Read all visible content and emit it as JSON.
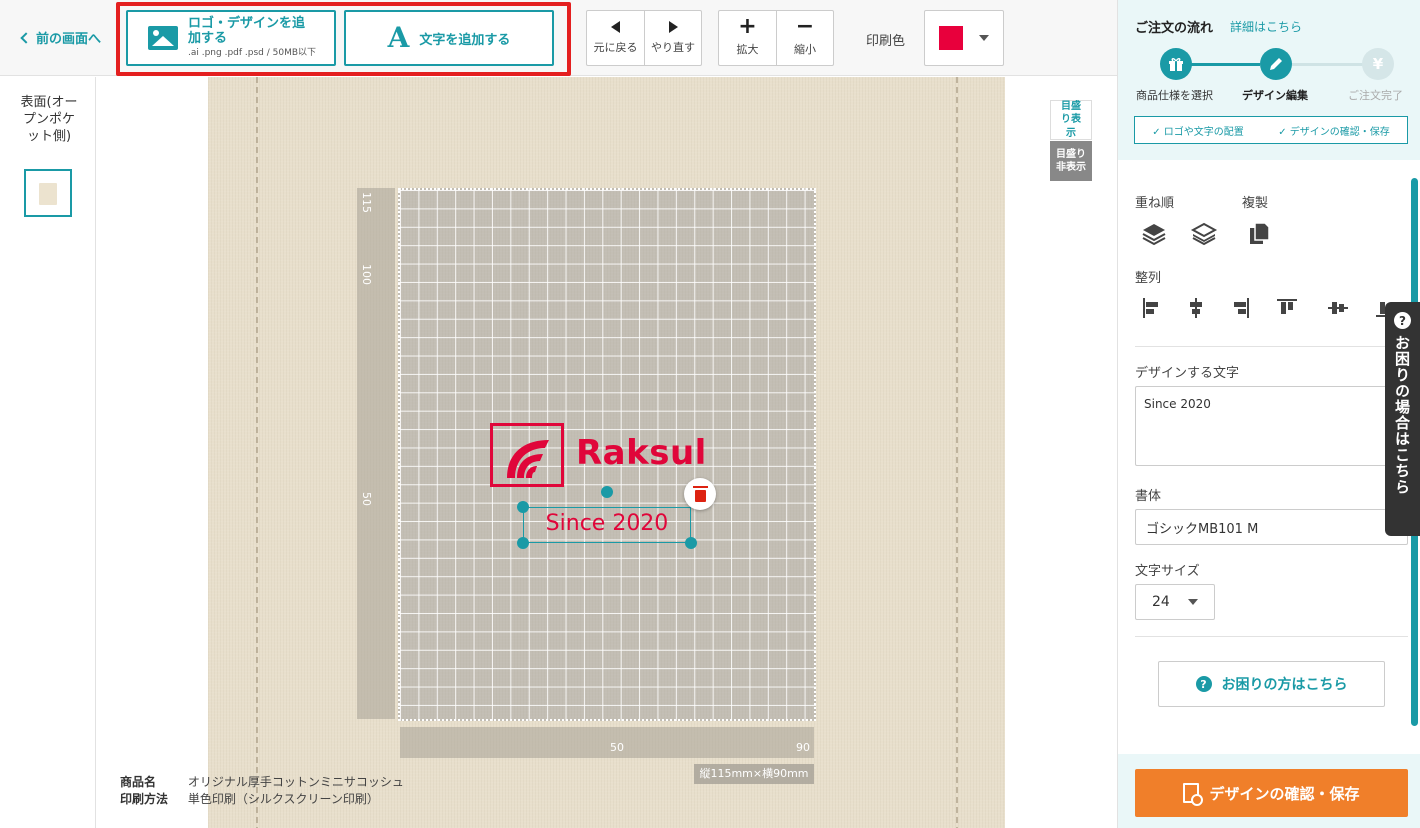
{
  "header": {
    "back_label": "前の画面へ",
    "add_logo_label": "ロゴ・デザインを追加する",
    "add_logo_sub": ".ai .png .pdf .psd / 50MB以下",
    "add_text_label": "文字を追加する",
    "add_text_icon_glyph": "A",
    "undo_label": "元に戻る",
    "redo_label": "やり直す",
    "zoom_in_label": "拡大",
    "zoom_out_label": "縮小",
    "print_color_label": "印刷色",
    "print_color_value": "#e8003c"
  },
  "side": {
    "face_label": "表面(オープンポケット側)"
  },
  "canvas": {
    "grid_show_label": "目盛り表示",
    "grid_hide_label": "目盛り非表示",
    "ruler_v": [
      "115",
      "100",
      "50"
    ],
    "ruler_h": [
      "50",
      "90"
    ],
    "size_label": "縦115mm×横90mm",
    "logo_text": "Raksul",
    "text_object": "Since 2020",
    "product_name_key": "商品名",
    "product_name": "オリジナル厚手コットンミニサコッシュ",
    "print_method_key": "印刷方法",
    "print_method": "単色印刷（シルクスクリーン印刷）"
  },
  "panel": {
    "flow_title": "ご注文の流れ",
    "flow_link": "詳細はこちら",
    "steps": [
      {
        "label": "商品仕様を選択",
        "state": "done"
      },
      {
        "label": "デザイン編集",
        "state": "current"
      },
      {
        "label": "ご注文完了",
        "state": "pending"
      }
    ],
    "sub_step_1": "✓ ロゴや文字の配置",
    "sub_step_2": "✓ デザインの確認・保存",
    "stack_order_label": "重ね順",
    "duplicate_label": "複製",
    "align_label": "整列",
    "text_label": "デザインする文字",
    "text_value": "Since 2020",
    "font_label": "書体",
    "font_value": "ゴシックMB101 M",
    "size_label": "文字サイズ",
    "size_value": "24",
    "help_button": "お困りの方はこちら",
    "confirm_button": "デザインの確認・保存",
    "accent_color": "#1a9aa6",
    "confirm_color": "#f07f2a"
  },
  "help_tab": {
    "label": "お困りの場合はこちら"
  }
}
